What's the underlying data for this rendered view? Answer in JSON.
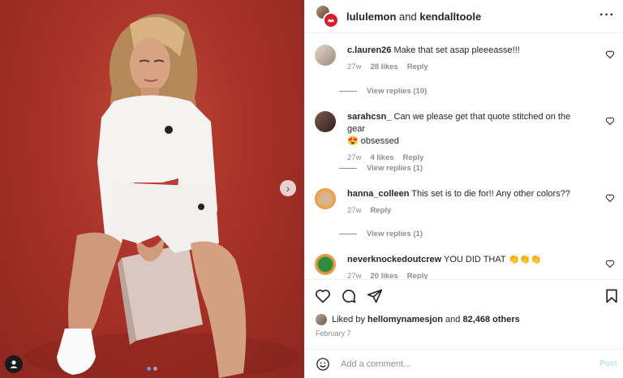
{
  "post": {
    "author": "lululemon",
    "conjunction": "and",
    "collaborator": "kendalltoole",
    "more_icon": "ellipsis-horizontal-icon",
    "brand_color": "#d31e2b"
  },
  "photo": {
    "next_icon": "chevron-right-icon",
    "user_tag_icon": "person-icon",
    "carousel_total": 2,
    "carousel_active": 1
  },
  "comments": [
    {
      "user": "c.lauren26",
      "text": "Make that set asap pleeeasse!!!",
      "text2": "",
      "time": "27w",
      "likes": "28 likes",
      "reply": "Reply",
      "view_replies": "View replies (10)"
    },
    {
      "user": "sarahcsn_",
      "text": "Can we please get that quote stitched on the gear",
      "text2": "😍 obsessed",
      "time": "27w",
      "likes": "4 likes",
      "reply": "Reply",
      "view_replies": "View replies (1)"
    },
    {
      "user": "hanna_colleen",
      "text": "This set is to die for!! Any other colors??",
      "text2": "",
      "time": "27w",
      "likes": "",
      "reply": "Reply",
      "view_replies": "View replies (1)"
    },
    {
      "user": "neverknockedoutcrew",
      "text": "YOU DID THAT 👏👏👏",
      "text2": "",
      "time": "27w",
      "likes": "20 likes",
      "reply": "Reply",
      "view_replies": ""
    }
  ],
  "actions": {
    "like_icon": "heart-icon",
    "comment_icon": "comment-icon",
    "share_icon": "send-icon",
    "save_icon": "bookmark-icon"
  },
  "likes": {
    "prefix": "Liked by",
    "user": "hellomynamesjon",
    "conjunction": "and",
    "others": "82,468 others"
  },
  "date": "February 7",
  "add_comment": {
    "placeholder": "Add a comment...",
    "post_label": "Post",
    "emoji_icon": "smiley-icon"
  }
}
